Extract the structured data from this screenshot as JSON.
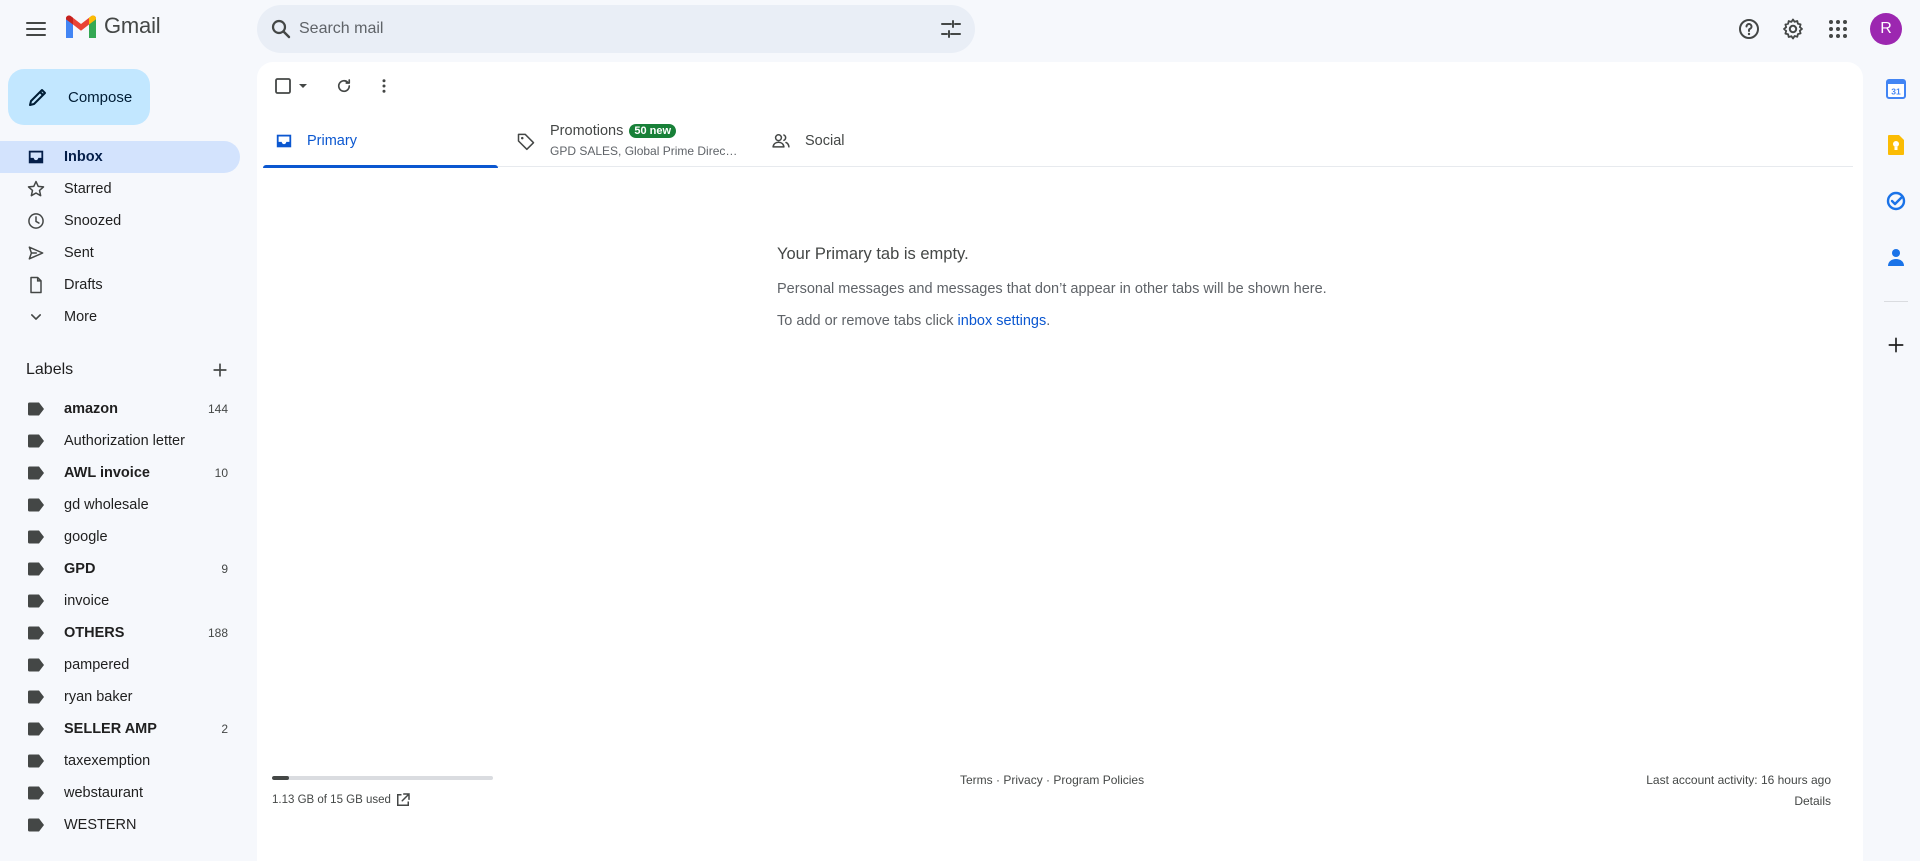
{
  "app": {
    "logo_text": "Gmail",
    "brand_colors": [
      "#ea4335",
      "#4285f4",
      "#34a853",
      "#fbbc04",
      "#c5221f"
    ]
  },
  "header": {
    "search_placeholder": "Search mail",
    "avatar_initial": "R",
    "avatar_color": "#9c27b0"
  },
  "sidebar": {
    "compose_label": "Compose",
    "nav": [
      {
        "label": "Inbox",
        "icon": "inbox-icon",
        "active": true
      },
      {
        "label": "Starred",
        "icon": "star-icon"
      },
      {
        "label": "Snoozed",
        "icon": "clock-icon"
      },
      {
        "label": "Sent",
        "icon": "send-icon"
      },
      {
        "label": "Drafts",
        "icon": "draft-icon"
      },
      {
        "label": "More",
        "icon": "chevron-down-icon"
      }
    ],
    "labels_title": "Labels",
    "labels": [
      {
        "name": "amazon",
        "count": "144",
        "bold": true
      },
      {
        "name": "Authorization letter",
        "count": "",
        "bold": false
      },
      {
        "name": "AWL invoice",
        "count": "10",
        "bold": true
      },
      {
        "name": "gd wholesale",
        "count": "",
        "bold": false
      },
      {
        "name": "google",
        "count": "",
        "bold": false
      },
      {
        "name": "GPD",
        "count": "9",
        "bold": true
      },
      {
        "name": "invoice",
        "count": "",
        "bold": false
      },
      {
        "name": "OTHERS",
        "count": "188",
        "bold": true
      },
      {
        "name": "pampered",
        "count": "",
        "bold": false
      },
      {
        "name": "ryan baker",
        "count": "",
        "bold": false
      },
      {
        "name": "SELLER AMP",
        "count": "2",
        "bold": true
      },
      {
        "name": "taxexemption",
        "count": "",
        "bold": false
      },
      {
        "name": "webstaurant",
        "count": "",
        "bold": false
      },
      {
        "name": "WESTERN",
        "count": "",
        "bold": false
      }
    ]
  },
  "tabs": {
    "primary": {
      "label": "Primary"
    },
    "promotions": {
      "label": "Promotions",
      "badge": "50 new",
      "subtitle": "GPD SALES, Global Prime Direct…"
    },
    "social": {
      "label": "Social"
    }
  },
  "empty_state": {
    "title": "Your Primary tab is empty.",
    "line1": "Personal messages and messages that don’t appear in other tabs will be shown here.",
    "line2_prefix": "To add or remove tabs click ",
    "line2_link": "inbox settings",
    "line2_suffix": "."
  },
  "footer": {
    "storage_text": "1.13 GB of 15 GB used",
    "storage_fraction": 0.075,
    "terms": "Terms",
    "privacy": "Privacy",
    "program_policies": "Program Policies",
    "separator": "·",
    "last_activity": "Last account activity: 16 hours ago",
    "details": "Details"
  }
}
